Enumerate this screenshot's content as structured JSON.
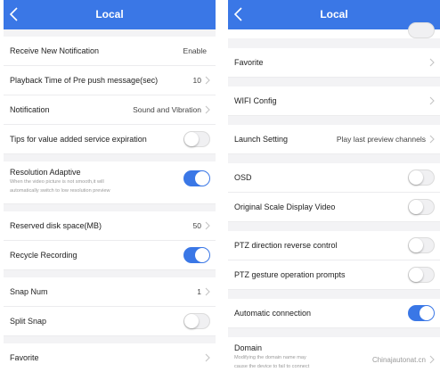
{
  "left": {
    "title": "Local",
    "receive_notification": {
      "label": "Receive New Notification",
      "value": "Enable"
    },
    "playback_time": {
      "label": "Playback Time of Pre push message(sec)",
      "value": "10"
    },
    "notification": {
      "label": "Notification",
      "value": "Sound and Vibration"
    },
    "tips_value_added": {
      "label": "Tips for value added service expiration",
      "enabled": false
    },
    "resolution_adaptive": {
      "label": "Resolution Adaptive",
      "description_line1": "When the video picture is not smooth,it will",
      "description_line2": "automatically switch to low resolution preview",
      "enabled": true
    },
    "reserved_disk": {
      "label": "Reserved disk space(MB)",
      "value": "50"
    },
    "recycle_recording": {
      "label": "Recycle Recording",
      "enabled": true
    },
    "snap_num": {
      "label": "Snap Num",
      "value": "1"
    },
    "split_snap": {
      "label": "Split Snap",
      "enabled": false
    },
    "favorite": {
      "label": "Favorite"
    }
  },
  "right": {
    "title": "Local",
    "favorite": {
      "label": "Favorite"
    },
    "wifi_config": {
      "label": "WIFI Config"
    },
    "launch_setting": {
      "label": "Launch Setting",
      "value": "Play last preview channels"
    },
    "osd": {
      "label": "OSD",
      "enabled": false
    },
    "original_scale": {
      "label": "Original Scale Display Video",
      "enabled": false
    },
    "ptz_reverse": {
      "label": "PTZ direction reverse control",
      "enabled": false
    },
    "ptz_gesture": {
      "label": "PTZ gesture operation prompts",
      "enabled": false
    },
    "auto_connection": {
      "label": "Automatic connection",
      "enabled": true
    },
    "domain": {
      "label": "Domain",
      "description_line1": "Modifying the domain name may",
      "description_line2": "cause the device to fail to connect",
      "value": "Chinajautonat.cn"
    }
  },
  "colors": {
    "accent": "#3a77e6",
    "background": "#f3f3f5"
  },
  "icons": {
    "back": "chevron-left-icon",
    "disclosure": "chevron-right-icon"
  }
}
